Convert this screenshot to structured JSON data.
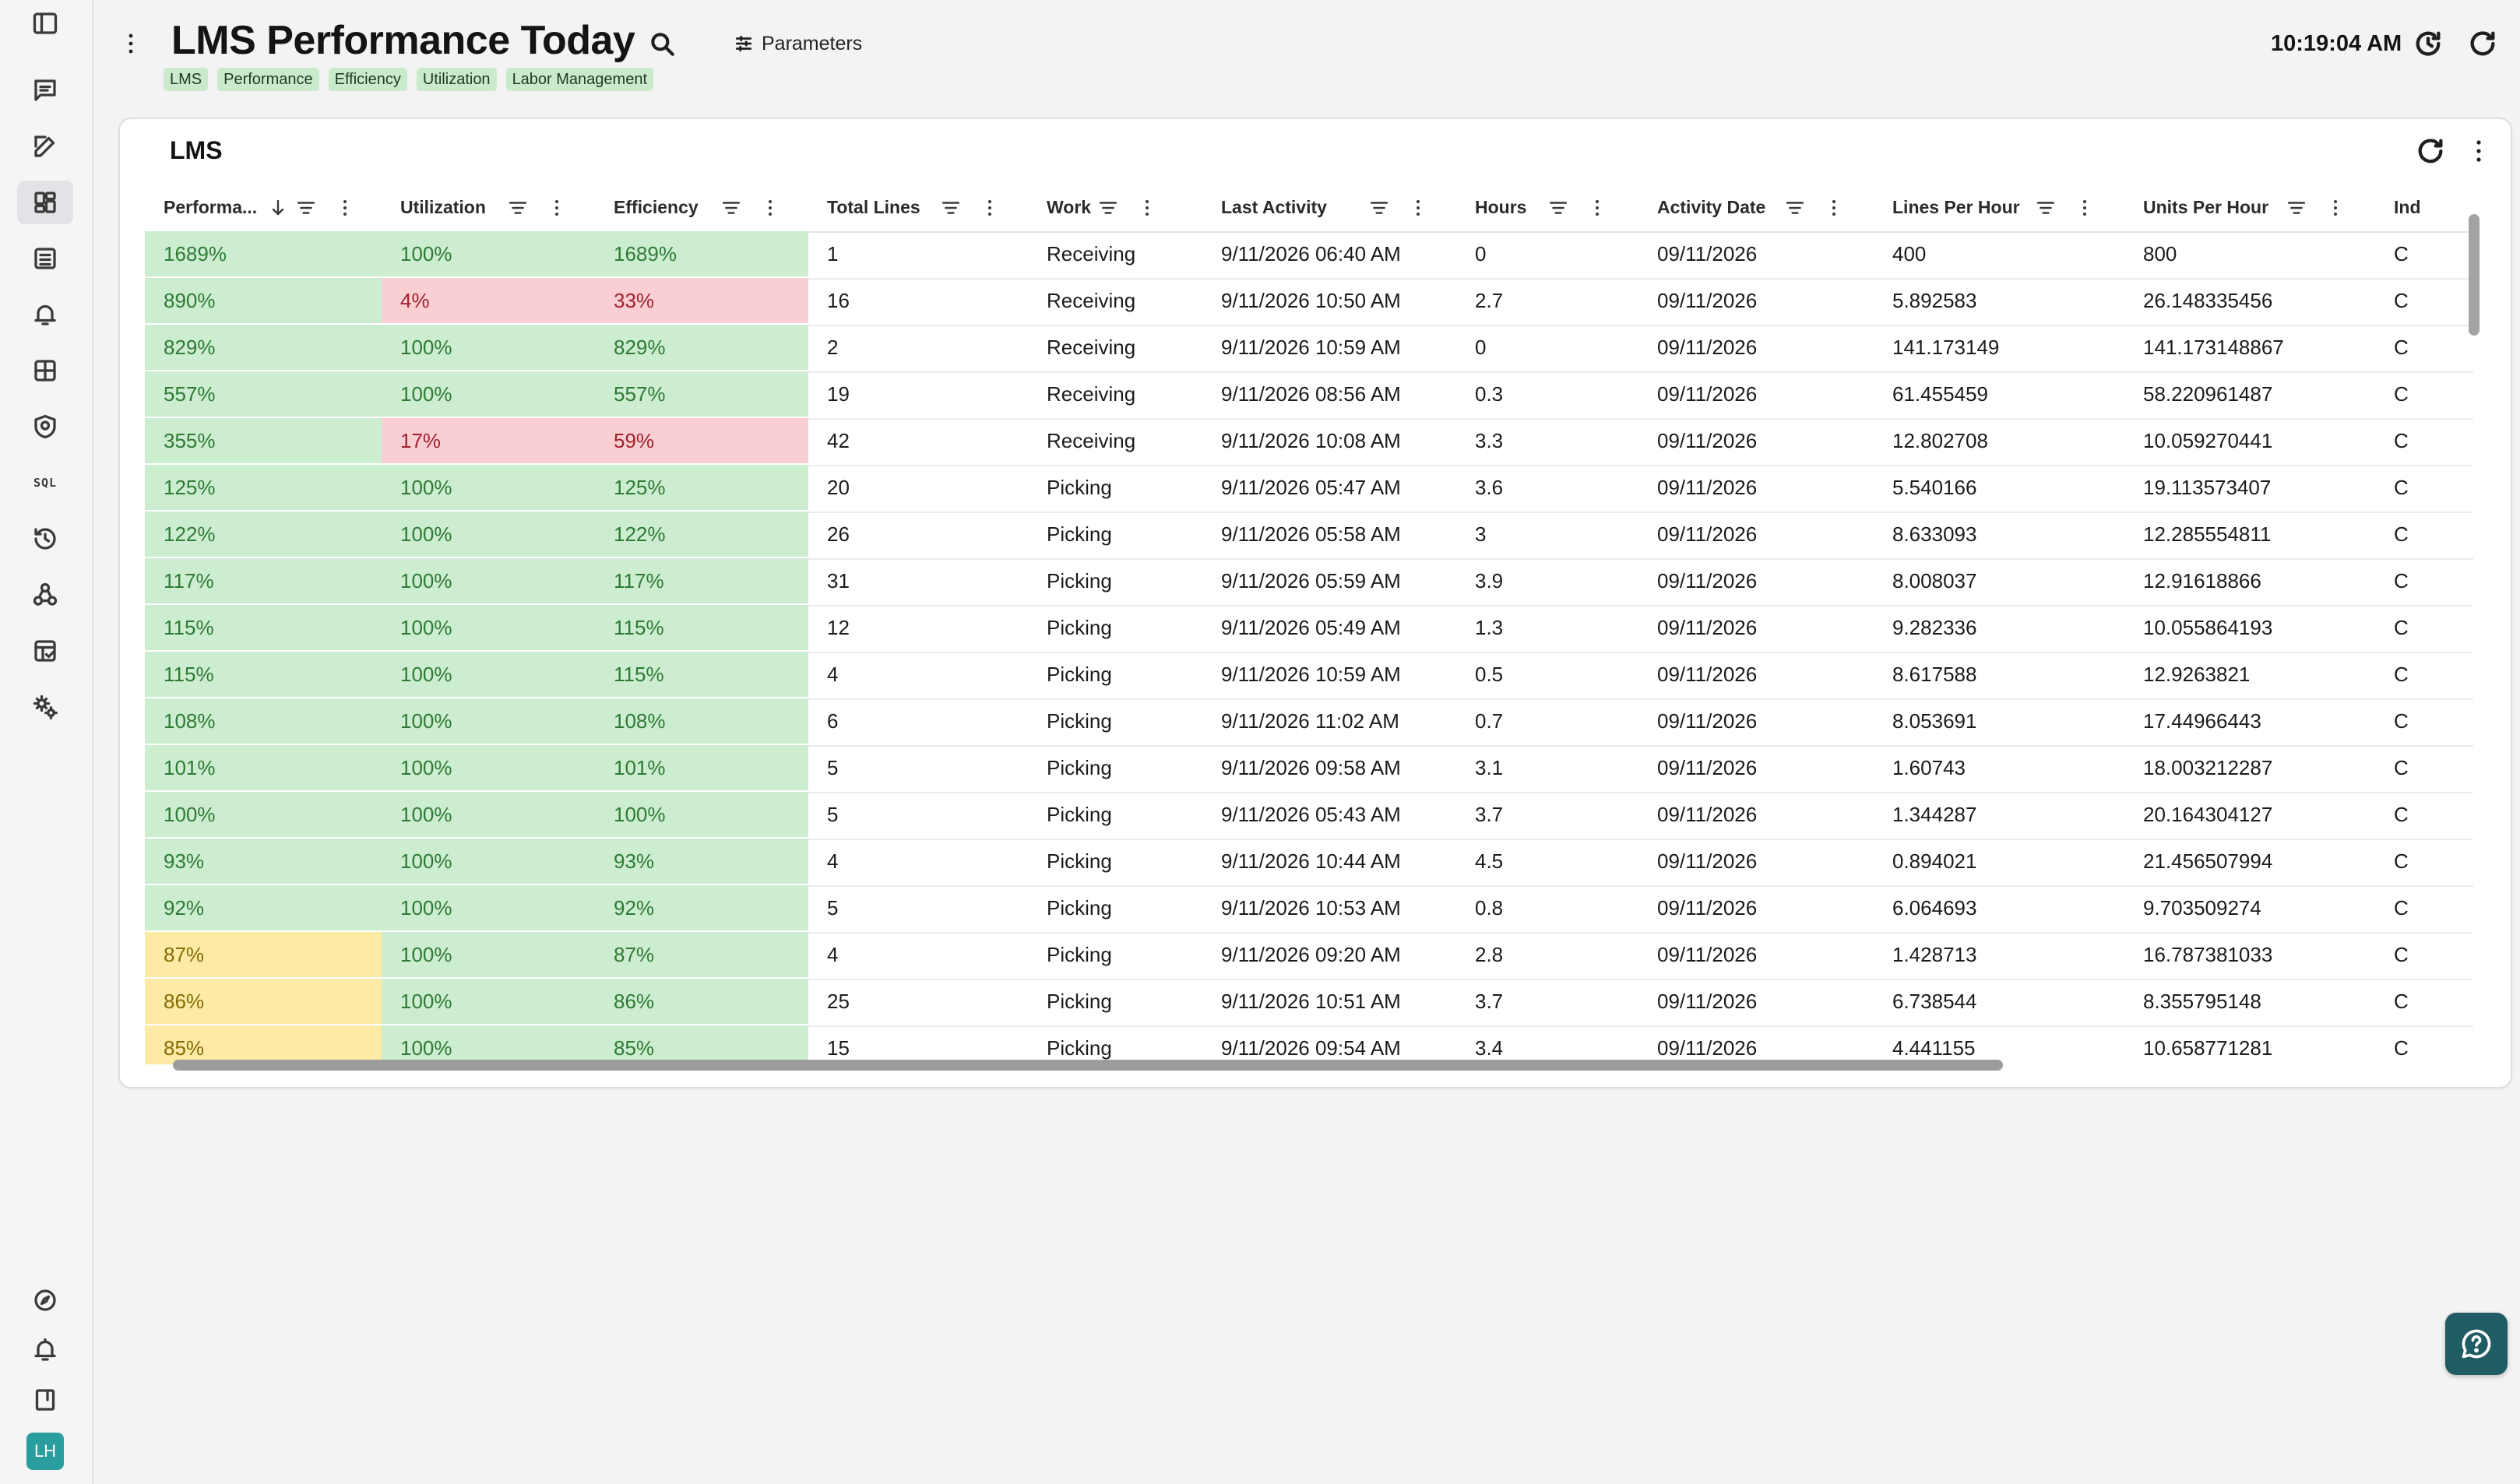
{
  "page": {
    "title": "LMS Performance Today",
    "parameters_label": "Parameters",
    "tags": [
      "LMS",
      "Performance",
      "Efficiency",
      "Utilization",
      "Labor Management"
    ],
    "clock": "10:19:04 AM"
  },
  "sidebar": {
    "top_items": [
      {
        "name": "sidebar-toggle-icon"
      },
      {
        "name": "chat-icon"
      },
      {
        "name": "edit-icon"
      },
      {
        "name": "dashboard-icon"
      },
      {
        "name": "list-icon"
      },
      {
        "name": "alert-bell-icon"
      },
      {
        "name": "apps-grid-icon"
      },
      {
        "name": "shield-icon"
      },
      {
        "name": "sql-icon",
        "text": "SQL"
      },
      {
        "name": "history-icon"
      },
      {
        "name": "webhook-icon"
      },
      {
        "name": "table-check-icon"
      },
      {
        "name": "settings-gears-icon"
      }
    ],
    "active_item": "dashboard-icon",
    "bottom_items": [
      {
        "name": "compass-icon"
      },
      {
        "name": "notifications-bell-icon"
      },
      {
        "name": "book-icon"
      }
    ],
    "avatar_initials": "LH"
  },
  "card": {
    "title": "LMS",
    "columns": [
      {
        "key": "perf",
        "label": "Performa...",
        "sorted": "desc"
      },
      {
        "key": "util",
        "label": "Utilization"
      },
      {
        "key": "eff",
        "label": "Efficiency"
      },
      {
        "key": "lines",
        "label": "Total Lines"
      },
      {
        "key": "work",
        "label": "Work"
      },
      {
        "key": "last",
        "label": "Last Activity"
      },
      {
        "key": "hours",
        "label": "Hours"
      },
      {
        "key": "date",
        "label": "Activity Date"
      },
      {
        "key": "lph",
        "label": "Lines Per Hour"
      },
      {
        "key": "uph",
        "label": "Units Per Hour"
      },
      {
        "key": "ind",
        "label": "Ind"
      }
    ],
    "status_colors": {
      "good": "#ccedcf",
      "bad": "#f9cfd4",
      "warn": "#fdeba5"
    },
    "rows": [
      {
        "perf": "1689%",
        "util": "100%",
        "eff": "1689%",
        "lines": "1",
        "work": "Receiving",
        "last": "9/11/2026 06:40 AM",
        "hours": "0",
        "date": "09/11/2026",
        "lph": "400",
        "uph": "800",
        "ind": "C",
        "perf_s": "g",
        "util_s": "g",
        "eff_s": "g"
      },
      {
        "perf": "890%",
        "util": "4%",
        "eff": "33%",
        "lines": "16",
        "work": "Receiving",
        "last": "9/11/2026 10:50 AM",
        "hours": "2.7",
        "date": "09/11/2026",
        "lph": "5.892583",
        "uph": "26.148335456",
        "ind": "C",
        "perf_s": "g",
        "util_s": "r",
        "eff_s": "r"
      },
      {
        "perf": "829%",
        "util": "100%",
        "eff": "829%",
        "lines": "2",
        "work": "Receiving",
        "last": "9/11/2026 10:59 AM",
        "hours": "0",
        "date": "09/11/2026",
        "lph": "141.173149",
        "uph": "141.173148867",
        "ind": "C",
        "perf_s": "g",
        "util_s": "g",
        "eff_s": "g"
      },
      {
        "perf": "557%",
        "util": "100%",
        "eff": "557%",
        "lines": "19",
        "work": "Receiving",
        "last": "9/11/2026 08:56 AM",
        "hours": "0.3",
        "date": "09/11/2026",
        "lph": "61.455459",
        "uph": "58.220961487",
        "ind": "C",
        "perf_s": "g",
        "util_s": "g",
        "eff_s": "g"
      },
      {
        "perf": "355%",
        "util": "17%",
        "eff": "59%",
        "lines": "42",
        "work": "Receiving",
        "last": "9/11/2026 10:08 AM",
        "hours": "3.3",
        "date": "09/11/2026",
        "lph": "12.802708",
        "uph": "10.059270441",
        "ind": "C",
        "perf_s": "g",
        "util_s": "r",
        "eff_s": "r"
      },
      {
        "perf": "125%",
        "util": "100%",
        "eff": "125%",
        "lines": "20",
        "work": "Picking",
        "last": "9/11/2026 05:47 AM",
        "hours": "3.6",
        "date": "09/11/2026",
        "lph": "5.540166",
        "uph": "19.113573407",
        "ind": "C",
        "perf_s": "g",
        "util_s": "g",
        "eff_s": "g"
      },
      {
        "perf": "122%",
        "util": "100%",
        "eff": "122%",
        "lines": "26",
        "work": "Picking",
        "last": "9/11/2026 05:58 AM",
        "hours": "3",
        "date": "09/11/2026",
        "lph": "8.633093",
        "uph": "12.285554811",
        "ind": "C",
        "perf_s": "g",
        "util_s": "g",
        "eff_s": "g"
      },
      {
        "perf": "117%",
        "util": "100%",
        "eff": "117%",
        "lines": "31",
        "work": "Picking",
        "last": "9/11/2026 05:59 AM",
        "hours": "3.9",
        "date": "09/11/2026",
        "lph": "8.008037",
        "uph": "12.91618866",
        "ind": "C",
        "perf_s": "g",
        "util_s": "g",
        "eff_s": "g"
      },
      {
        "perf": "115%",
        "util": "100%",
        "eff": "115%",
        "lines": "12",
        "work": "Picking",
        "last": "9/11/2026 05:49 AM",
        "hours": "1.3",
        "date": "09/11/2026",
        "lph": "9.282336",
        "uph": "10.055864193",
        "ind": "C",
        "perf_s": "g",
        "util_s": "g",
        "eff_s": "g"
      },
      {
        "perf": "115%",
        "util": "100%",
        "eff": "115%",
        "lines": "4",
        "work": "Picking",
        "last": "9/11/2026 10:59 AM",
        "hours": "0.5",
        "date": "09/11/2026",
        "lph": "8.617588",
        "uph": "12.9263821",
        "ind": "C",
        "perf_s": "g",
        "util_s": "g",
        "eff_s": "g"
      },
      {
        "perf": "108%",
        "util": "100%",
        "eff": "108%",
        "lines": "6",
        "work": "Picking",
        "last": "9/11/2026 11:02 AM",
        "hours": "0.7",
        "date": "09/11/2026",
        "lph": "8.053691",
        "uph": "17.44966443",
        "ind": "C",
        "perf_s": "g",
        "util_s": "g",
        "eff_s": "g"
      },
      {
        "perf": "101%",
        "util": "100%",
        "eff": "101%",
        "lines": "5",
        "work": "Picking",
        "last": "9/11/2026 09:58 AM",
        "hours": "3.1",
        "date": "09/11/2026",
        "lph": "1.60743",
        "uph": "18.003212287",
        "ind": "C",
        "perf_s": "g",
        "util_s": "g",
        "eff_s": "g"
      },
      {
        "perf": "100%",
        "util": "100%",
        "eff": "100%",
        "lines": "5",
        "work": "Picking",
        "last": "9/11/2026 05:43 AM",
        "hours": "3.7",
        "date": "09/11/2026",
        "lph": "1.344287",
        "uph": "20.164304127",
        "ind": "C",
        "perf_s": "g",
        "util_s": "g",
        "eff_s": "g"
      },
      {
        "perf": "93%",
        "util": "100%",
        "eff": "93%",
        "lines": "4",
        "work": "Picking",
        "last": "9/11/2026 10:44 AM",
        "hours": "4.5",
        "date": "09/11/2026",
        "lph": "0.894021",
        "uph": "21.456507994",
        "ind": "C",
        "perf_s": "g",
        "util_s": "g",
        "eff_s": "g"
      },
      {
        "perf": "92%",
        "util": "100%",
        "eff": "92%",
        "lines": "5",
        "work": "Picking",
        "last": "9/11/2026 10:53 AM",
        "hours": "0.8",
        "date": "09/11/2026",
        "lph": "6.064693",
        "uph": "9.703509274",
        "ind": "C",
        "perf_s": "g",
        "util_s": "g",
        "eff_s": "g"
      },
      {
        "perf": "87%",
        "util": "100%",
        "eff": "87%",
        "lines": "4",
        "work": "Picking",
        "last": "9/11/2026 09:20 AM",
        "hours": "2.8",
        "date": "09/11/2026",
        "lph": "1.428713",
        "uph": "16.787381033",
        "ind": "C",
        "perf_s": "y",
        "util_s": "g",
        "eff_s": "g"
      },
      {
        "perf": "86%",
        "util": "100%",
        "eff": "86%",
        "lines": "25",
        "work": "Picking",
        "last": "9/11/2026 10:51 AM",
        "hours": "3.7",
        "date": "09/11/2026",
        "lph": "6.738544",
        "uph": "8.355795148",
        "ind": "C",
        "perf_s": "y",
        "util_s": "g",
        "eff_s": "g"
      },
      {
        "perf": "85%",
        "util": "100%",
        "eff": "85%",
        "lines": "15",
        "work": "Picking",
        "last": "9/11/2026 09:54 AM",
        "hours": "3.4",
        "date": "09/11/2026",
        "lph": "4.441155",
        "uph": "10.658771281",
        "ind": "C",
        "perf_s": "y",
        "util_s": "g",
        "eff_s": "g"
      }
    ]
  }
}
